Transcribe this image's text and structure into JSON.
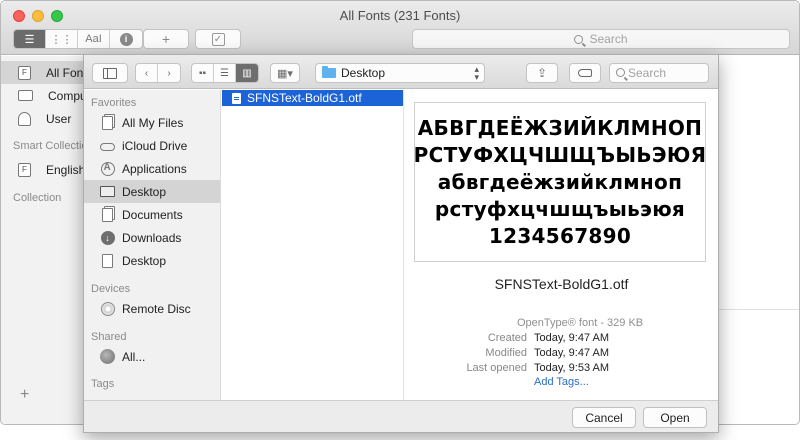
{
  "window": {
    "title": "All Fonts (231 Fonts)",
    "search_placeholder": "Search",
    "toolbar_text_button": "AaI",
    "add_symbol": "+",
    "check_symbol": "✓",
    "info_symbol": "i"
  },
  "main_sidebar": {
    "items": [
      {
        "label": "All Fonts",
        "icon": "font-collection-icon",
        "selected": true
      },
      {
        "label": "Computer",
        "icon": "computer-icon"
      },
      {
        "label": "User",
        "icon": "user-icon"
      }
    ],
    "smart_collection_header": "Smart Collection",
    "smart_items": [
      {
        "label": "English",
        "icon": "font-collection-icon"
      }
    ],
    "collection_header": "Collection",
    "add_label": "+"
  },
  "sheet": {
    "path_folder": "Desktop",
    "search_placeholder": "Search",
    "favorites_header": "Favorites",
    "favorites": [
      {
        "label": "All My Files",
        "icon": "all-files-icon"
      },
      {
        "label": "iCloud Drive",
        "icon": "cloud-icon"
      },
      {
        "label": "Applications",
        "icon": "applications-icon"
      },
      {
        "label": "Desktop",
        "icon": "desktop-icon",
        "selected": true
      },
      {
        "label": "Documents",
        "icon": "documents-icon"
      },
      {
        "label": "Downloads",
        "icon": "downloads-icon"
      },
      {
        "label": "Desktop",
        "icon": "document-icon"
      }
    ],
    "devices_header": "Devices",
    "devices": [
      {
        "label": "Remote Disc",
        "icon": "disc-icon"
      }
    ],
    "shared_header": "Shared",
    "shared": [
      {
        "label": "All...",
        "icon": "network-globe-icon"
      }
    ],
    "tags_header": "Tags",
    "files": [
      {
        "name": "SFNSText-BoldG1.otf",
        "selected": true
      }
    ],
    "preview": {
      "lines": [
        "АБВГДЕЁЖЗИЙКЛМНОП",
        "РСТУФХЦЧШЩЪЫЬЭЮЯ",
        "абвгдеёжзийклмноп",
        "рстуфхцчшщъыьэюя",
        "1234567890"
      ],
      "filename": "SFNSText-BoldG1.otf",
      "kind": "OpenType® font - 329 KB",
      "created_label": "Created",
      "created_value": "Today, 9:47 AM",
      "modified_label": "Modified",
      "modified_value": "Today, 9:47 AM",
      "last_opened_label": "Last opened",
      "last_opened_value": "Today, 9:53 AM",
      "add_tags": "Add Tags..."
    },
    "cancel_label": "Cancel",
    "open_label": "Open"
  },
  "colors": {
    "selection_blue": "#1c63d8",
    "link_blue": "#2a6ec7",
    "folder_blue": "#5fb2ee"
  }
}
